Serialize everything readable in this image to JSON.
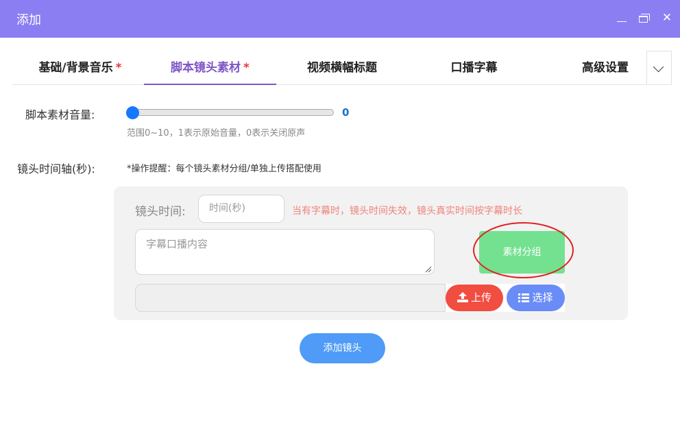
{
  "window": {
    "title": "添加",
    "close_glyph": "✕"
  },
  "tabs": [
    {
      "label": "基础/背景音乐",
      "required": "*"
    },
    {
      "label": "脚本镜头素材",
      "required": "*",
      "active": true
    },
    {
      "label": "视频横幅标题"
    },
    {
      "label": "口播字幕"
    },
    {
      "label": "高级设置"
    }
  ],
  "volume": {
    "label": "脚本素材音量:",
    "value": "0",
    "level": 0,
    "hint": "范围0~10，1表示原始音量，0表示关闭原声"
  },
  "timeline": {
    "label": "镜头时间轴(秒):",
    "tip": "*操作提醒：每个镜头素材分组/单独上传搭配使用"
  },
  "shot": {
    "time_label": "镜头时间:",
    "time_placeholder": "时间(秒)",
    "time_warning": "当有字幕时，镜头时间失效，镜头真实时间按字幕时长",
    "subtitle_placeholder": "字幕口播内容",
    "group_button": "素材分组",
    "upload_button": "上传",
    "select_button": "选择"
  },
  "add_shot_button": "添加镜头",
  "colors": {
    "titlebar": "#8b7ef3",
    "active_tab": "#7d55c7",
    "group_button": "#74e191",
    "upload_button": "#f14d40",
    "select_button": "#6a8cf7",
    "add_button": "#4f9bf7",
    "highlight_ellipse": "#e02020"
  },
  "icons": [
    "minimize-icon",
    "maximize-icon",
    "close-icon",
    "chevron-down-icon",
    "upload-icon",
    "list-icon"
  ]
}
